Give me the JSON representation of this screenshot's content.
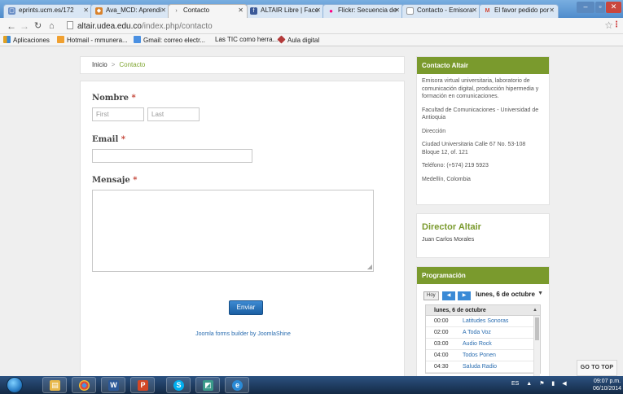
{
  "browser": {
    "tabs": [
      {
        "title": "eprints.ucm.es/172",
        "active": false
      },
      {
        "title": "Ava_MCD: Aprendi",
        "active": false
      },
      {
        "title": "Contacto",
        "active": true
      },
      {
        "title": "ALTAIR Libre | Face",
        "active": false
      },
      {
        "title": "Flickr: Secuencia de",
        "active": false
      },
      {
        "title": "Contacto - Emisora",
        "active": false
      },
      {
        "title": "El favor pedido por",
        "active": false
      }
    ],
    "url_domain": "altair.udea.edu.co",
    "url_path": "/index.php/contacto",
    "bookmarks": [
      {
        "label": "Aplicaciones",
        "color": "#e0a020"
      },
      {
        "label": "Hotmail - mmunera...",
        "color": "#f0a030"
      },
      {
        "label": "Gmail: correo electr...",
        "color": "#4a90e2"
      },
      {
        "label": "Las TIC como herra...",
        "color": ""
      },
      {
        "label": "Aula digital",
        "color": "#b33a3a"
      }
    ]
  },
  "breadcrumb": {
    "home": "Inicio",
    "separator": ">",
    "current": "Contacto"
  },
  "form": {
    "name_label": "Nombre",
    "required_mark": "*",
    "first_placeholder": "First",
    "last_placeholder": "Last",
    "email_label": "Email",
    "message_label": "Mensaje",
    "submit_label": "Enviar",
    "powered_by": "Joomla forms builder by JoomlaShine"
  },
  "sidebar": {
    "contact_title": "Contacto Altair",
    "contact_paragraphs": [
      "Emisora virtual universitaria, laboratorio de comunicación digital, producción hipermedia y formación en comunicaciones.",
      "Facultad de Comunicaciones - Universidad de Antioquia",
      "Dirección",
      "Ciudad Universitaria Calle 67 No. 53-108 Bloque 12, of. 121",
      "Teléfono: (+574) 219 5923",
      "Medellín, Colombia"
    ],
    "director_title": "Director Altair",
    "director_name": "Juan Carlos Morales",
    "programacion_title": "Programación",
    "calendar": {
      "today_label": "Hoy",
      "date_label": "lunes, 6 de octubre",
      "agenda_header": "lunes, 6 de octubre",
      "rows": [
        {
          "time": "00:00",
          "name": "Latitudes Sonoras"
        },
        {
          "time": "02:00",
          "name": "A Toda Voz"
        },
        {
          "time": "03:00",
          "name": "Audio Rock"
        },
        {
          "time": "04:00",
          "name": "Todos Ponen"
        },
        {
          "time": "04:30",
          "name": "Saluda Radio"
        }
      ]
    }
  },
  "go_to_top": "GO TO TOP",
  "taskbar": {
    "lang": "ES",
    "time": "09:07 p.m.",
    "date": "06/10/2014"
  },
  "colors": {
    "accent_green": "#7a9a2d",
    "link_blue": "#2a6db0",
    "button_blue": "#1f6fb8",
    "required_red": "#c0392b"
  }
}
